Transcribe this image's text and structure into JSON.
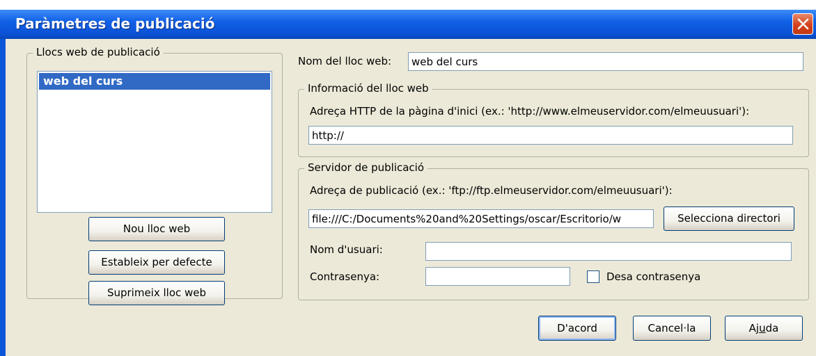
{
  "window": {
    "title": "Paràmetres de publicació"
  },
  "sites_group": {
    "legend": "Llocs web de publicació",
    "items": [
      "web del curs"
    ],
    "buttons": {
      "new": "Nou lloc web",
      "set_default": "Estableix per defecte",
      "delete": "Suprimeix lloc web"
    }
  },
  "site_name": {
    "label": "Nom del lloc web:",
    "value": "web del curs"
  },
  "site_info": {
    "legend": "Informació del lloc web",
    "http_label": "Adreça HTTP de la pàgina d'inici (ex.: 'http://www.elmeuservidor.com/elmeuusuari'):",
    "http_value": "http://"
  },
  "server": {
    "legend": "Servidor de publicació",
    "address_label": "Adreça de publicació (ex.: 'ftp://ftp.elmeuservidor.com/elmeuusuari'):",
    "address_value": "file:///C:/Documents%20and%20Settings/oscar/Escritorio/w",
    "select_dir": "Selecciona directori",
    "user_label": "Nom d'usuari:",
    "user_value": "",
    "password_label": "Contrasenya:",
    "password_value": "",
    "save_password": "Desa contrasenya",
    "save_password_checked": false
  },
  "footer": {
    "ok": "D'acord",
    "cancel_pre": "Cancel·la",
    "help_pre": "Aj",
    "help_accel": "u",
    "help_post": "da"
  },
  "colors": {
    "titlebar": "#0a56d8",
    "selection": "#316ac5",
    "dialog_bg": "#ece9d8"
  }
}
